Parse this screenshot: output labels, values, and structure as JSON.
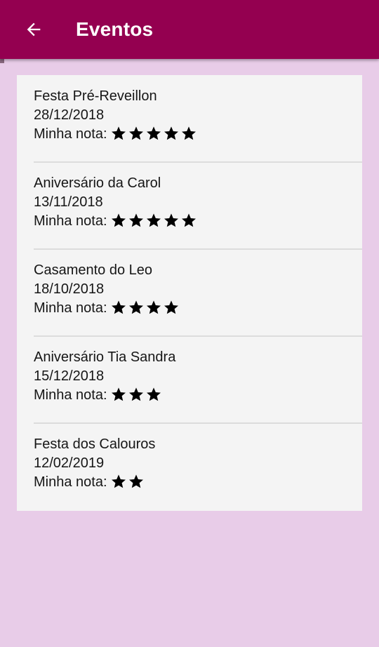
{
  "app_bar": {
    "title": "Eventos",
    "back_icon": "arrow-back-icon",
    "background": "#940050"
  },
  "page": {
    "background": "#e8cce8",
    "card_background": "#f4f4f4"
  },
  "rating_label": "Minha nota:",
  "star_icon": "star-icon",
  "events": [
    {
      "name": "Festa Pré-Reveillon",
      "date": "28/12/2018",
      "rating": 5
    },
    {
      "name": "Aniversário da Carol",
      "date": "13/11/2018",
      "rating": 5
    },
    {
      "name": "Casamento do Leo",
      "date": "18/10/2018",
      "rating": 4
    },
    {
      "name": "Aniversário Tia Sandra",
      "date": "15/12/2018",
      "rating": 3
    },
    {
      "name": "Festa dos Calouros",
      "date": "12/02/2019",
      "rating": 2
    }
  ]
}
